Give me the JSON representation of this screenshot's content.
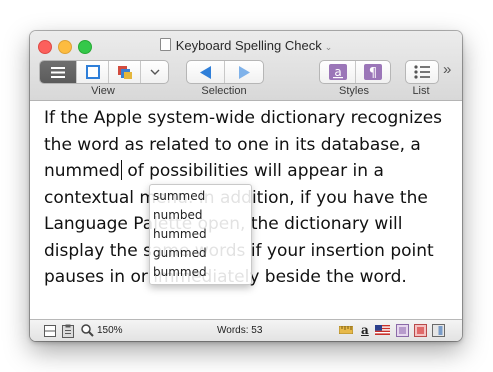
{
  "window": {
    "title": "Keyboard Spelling Check"
  },
  "toolbar": {
    "groups": [
      {
        "label": "View"
      },
      {
        "label": "Selection"
      },
      {
        "label": "Styles"
      },
      {
        "label": "List"
      }
    ],
    "overflow_label": "»"
  },
  "document": {
    "text_before": "If the Apple system-wide dictionary recognizes the word as related to one in its database, a nummed",
    "text_after": " of possibilities will appear in a contextual menu. In addition, if you have the Language Palette open, the dictionary will display the same words if your insertion point pauses in or immediately beside the word."
  },
  "suggestions": {
    "items": [
      "summed",
      "numbed",
      "hummed",
      "gummed",
      "bummed"
    ]
  },
  "status": {
    "zoom": "150%",
    "words": "Words: 53",
    "text_style_glyph": "a"
  },
  "colors": {
    "accent_blue": "#2f7fd9",
    "styles_purple": "#9b76b8",
    "close": "#fc605c",
    "minimize": "#fdbc40",
    "zoom": "#34c84a"
  }
}
